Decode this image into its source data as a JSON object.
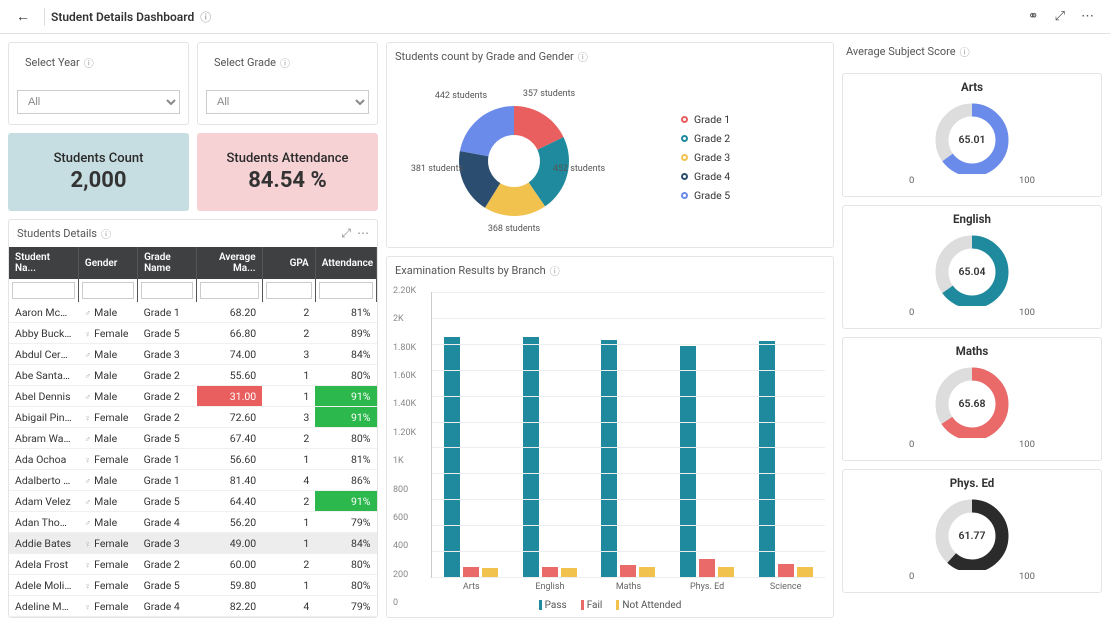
{
  "header": {
    "title": "Student Details Dashboard",
    "icons": {
      "back": "←",
      "info": "ⓘ",
      "link": "⚭",
      "expand": "⤢",
      "more": "⋯"
    }
  },
  "filters": {
    "year": {
      "title": "Select Year",
      "value": "All"
    },
    "grade": {
      "title": "Select Grade",
      "value": "All"
    }
  },
  "kpi": {
    "count_label": "Students Count",
    "count_value": "2,000",
    "att_label": "Students Attendance",
    "att_value": "84.54 %"
  },
  "donut": {
    "title": "Students count by Grade and Gender",
    "legend": [
      {
        "label": "Grade 1",
        "color": "#e95e5e"
      },
      {
        "label": "Grade 2",
        "color": "#1f8a9e"
      },
      {
        "label": "Grade 3",
        "color": "#f2c24e"
      },
      {
        "label": "Grade 4",
        "color": "#2b4d6f"
      },
      {
        "label": "Grade 5",
        "color": "#6b8bea"
      }
    ],
    "labels": [
      "357 students",
      "452 students",
      "368 students",
      "381 students",
      "442 students"
    ]
  },
  "details": {
    "title": "Students Details",
    "headers": [
      "Student Na...",
      "Gender",
      "Grade Name",
      "Average Ma...",
      "GPA",
      "Attendance"
    ],
    "rows": [
      {
        "n": "Aaron Mcgui...",
        "g": "Male",
        "gi": "♂",
        "gr": "Grade 1",
        "m": "68.20",
        "p": "2",
        "a": "81%"
      },
      {
        "n": "Abby Buckley",
        "g": "Female",
        "gi": "♀",
        "gr": "Grade 5",
        "m": "66.80",
        "p": "2",
        "a": "89%"
      },
      {
        "n": "Abdul Cerva...",
        "g": "Male",
        "gi": "♂",
        "gr": "Grade 3",
        "m": "74.00",
        "p": "3",
        "a": "84%"
      },
      {
        "n": "Abe Santana",
        "g": "Male",
        "gi": "♂",
        "gr": "Grade 2",
        "m": "55.60",
        "p": "1",
        "a": "80%"
      },
      {
        "n": "Abel Dennis",
        "g": "Male",
        "gi": "♂",
        "gr": "Grade 2",
        "m": "31.00",
        "p": "1",
        "a": "91%",
        "mred": true,
        "agr": true
      },
      {
        "n": "Abigail Pineda",
        "g": "Female",
        "gi": "♀",
        "gr": "Grade 2",
        "m": "72.60",
        "p": "3",
        "a": "91%",
        "agr": true
      },
      {
        "n": "Abram Walter",
        "g": "Male",
        "gi": "♂",
        "gr": "Grade 5",
        "m": "67.40",
        "p": "2",
        "a": "80%"
      },
      {
        "n": "Ada Ochoa",
        "g": "Female",
        "gi": "♀",
        "gr": "Grade 1",
        "m": "56.60",
        "p": "1",
        "a": "81%"
      },
      {
        "n": "Adalberto Ch...",
        "g": "Male",
        "gi": "♂",
        "gr": "Grade 1",
        "m": "81.40",
        "p": "4",
        "a": "86%"
      },
      {
        "n": "Adam Velez",
        "g": "Male",
        "gi": "♂",
        "gr": "Grade 5",
        "m": "64.40",
        "p": "2",
        "a": "91%",
        "agr": true
      },
      {
        "n": "Adan Thomp...",
        "g": "Male",
        "gi": "♂",
        "gr": "Grade 4",
        "m": "56.20",
        "p": "1",
        "a": "79%"
      },
      {
        "n": "Addie Bates",
        "g": "Female",
        "gi": "♀",
        "gr": "Grade 3",
        "m": "49.00",
        "p": "1",
        "a": "84%",
        "hl": true
      },
      {
        "n": "Adela Frost",
        "g": "Female",
        "gi": "♀",
        "gr": "Grade 2",
        "m": "60.00",
        "p": "2",
        "a": "80%"
      },
      {
        "n": "Adele Molina",
        "g": "Female",
        "gi": "♀",
        "gr": "Grade 5",
        "m": "59.80",
        "p": "1",
        "a": "80%"
      },
      {
        "n": "Adeline Mon...",
        "g": "Female",
        "gi": "♀",
        "gr": "Grade 4",
        "m": "82.20",
        "p": "4",
        "a": "79%"
      }
    ]
  },
  "exam": {
    "title": "Examination Results by Branch",
    "ymax": 2200,
    "yticks": [
      "2.20K",
      "2K",
      "1.80K",
      "1.60K",
      "1.40K",
      "1.20K",
      "1K",
      "800",
      "600",
      "400",
      "200",
      "0"
    ],
    "legend": [
      "Pass",
      "Fail",
      "Not Attended"
    ],
    "legend_colors": {
      "pass": "#1f8a9e",
      "fail": "#ea6a6a",
      "na": "#f2c24e"
    },
    "cats": [
      {
        "label": "Arts",
        "pass": 1850,
        "fail": 80,
        "na": 70
      },
      {
        "label": "English",
        "pass": 1850,
        "fail": 80,
        "na": 70
      },
      {
        "label": "Maths",
        "pass": 1830,
        "fail": 90,
        "na": 80
      },
      {
        "label": "Phys. Ed",
        "pass": 1780,
        "fail": 140,
        "na": 80
      },
      {
        "label": "Science",
        "pass": 1820,
        "fail": 100,
        "na": 80
      }
    ]
  },
  "gauges": {
    "title": "Average Subject Score",
    "range_min": "0",
    "range_max": "100",
    "items": [
      {
        "label": "Arts",
        "value": "65.01",
        "pct": 65.01,
        "color": "#6b8bea"
      },
      {
        "label": "English",
        "value": "65.04",
        "pct": 65.04,
        "color": "#1f8a9e"
      },
      {
        "label": "Maths",
        "value": "65.68",
        "pct": 65.68,
        "color": "#ea6a6a"
      },
      {
        "label": "Phys. Ed",
        "value": "61.77",
        "pct": 61.77,
        "color": "#2b2b2b"
      }
    ]
  },
  "chart_data": {
    "donut": {
      "type": "pie",
      "title": "Students count by Grade and Gender",
      "categories": [
        "Grade 1",
        "Grade 2",
        "Grade 3",
        "Grade 4",
        "Grade 5"
      ],
      "values": [
        357,
        452,
        368,
        381,
        442
      ]
    },
    "exam_results": {
      "type": "bar",
      "title": "Examination Results by Branch",
      "categories": [
        "Arts",
        "English",
        "Maths",
        "Phys. Ed",
        "Science"
      ],
      "series": [
        {
          "name": "Pass",
          "values": [
            1850,
            1850,
            1830,
            1780,
            1820
          ]
        },
        {
          "name": "Fail",
          "values": [
            80,
            80,
            90,
            140,
            100
          ]
        },
        {
          "name": "Not Attended",
          "values": [
            70,
            70,
            80,
            80,
            80
          ]
        }
      ],
      "ylim": [
        0,
        2200
      ]
    },
    "gauges": [
      {
        "type": "gauge",
        "title": "Arts",
        "value": 65.01,
        "min": 0,
        "max": 100
      },
      {
        "type": "gauge",
        "title": "English",
        "value": 65.04,
        "min": 0,
        "max": 100
      },
      {
        "type": "gauge",
        "title": "Maths",
        "value": 65.68,
        "min": 0,
        "max": 100
      },
      {
        "type": "gauge",
        "title": "Phys. Ed",
        "value": 61.77,
        "min": 0,
        "max": 100
      }
    ]
  }
}
